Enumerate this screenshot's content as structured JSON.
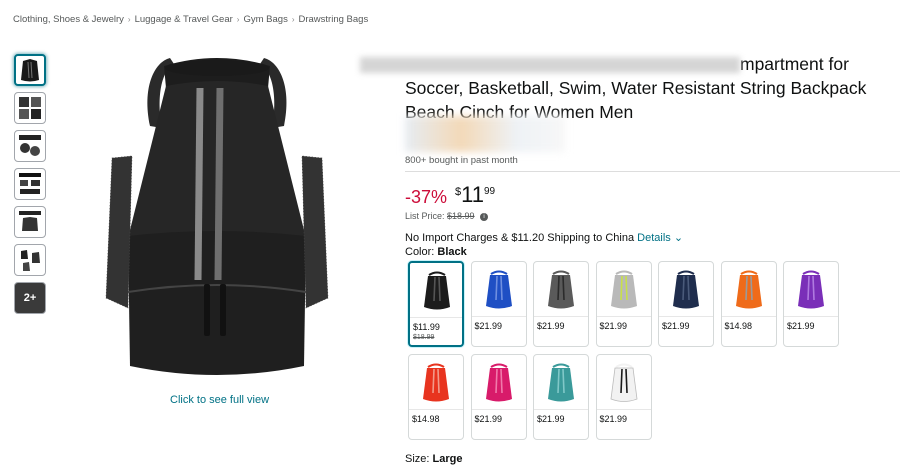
{
  "breadcrumb": [
    "Clothing, Shoes & Jewelry",
    "Luggage & Travel Gear",
    "Gym Bags",
    "Drawstring Bags"
  ],
  "breadcrumb_sep": "›",
  "thumbnails": {
    "more_label": "2+"
  },
  "see_full_link": "Click to see full view",
  "title": {
    "line1_visible": "mpartment for",
    "line2": "Soccer, Basketball, Swim, Water Resistant String Backpack",
    "line3": "Beach Cinch for Women Men"
  },
  "bought": "800+ bought in past month",
  "price": {
    "discount": "-37%",
    "currency": "$",
    "whole": "11",
    "fraction": "99",
    "list_label": "List Price:",
    "list_value": "$18.99",
    "info_icon": "i"
  },
  "shipping": {
    "text": "No Import Charges & $11.20 Shipping to China",
    "details_link": "Details",
    "chevron": "⌄"
  },
  "color": {
    "label": "Color:",
    "value": "Black"
  },
  "swatches": [
    {
      "price": "$11.99",
      "old": "$18.99",
      "color": "#1c1c1c",
      "accent": "#555555"
    },
    {
      "price": "$21.99",
      "old": "",
      "color": "#1f4fc4",
      "accent": "#6f8fe0"
    },
    {
      "price": "$21.99",
      "old": "",
      "color": "#5a5a5a",
      "accent": "#2b2b2b"
    },
    {
      "price": "$21.99",
      "old": "",
      "color": "#b9b9b9",
      "accent": "#c8e04a"
    },
    {
      "price": "$21.99",
      "old": "",
      "color": "#1f2d4d",
      "accent": "#4a5a7a"
    },
    {
      "price": "$14.98",
      "old": "",
      "color": "#ef6b1a",
      "accent": "#9a9a9a"
    },
    {
      "price": "$21.99",
      "old": "",
      "color": "#7a2fb8",
      "accent": "#b07ae0"
    },
    {
      "price": "$14.98",
      "old": "",
      "color": "#e8341f",
      "accent": "#f29a8a"
    },
    {
      "price": "$21.99",
      "old": "",
      "color": "#d81b6a",
      "accent": "#f07aab"
    },
    {
      "price": "$21.99",
      "old": "",
      "color": "#3a9a9a",
      "accent": "#80c8c8"
    },
    {
      "price": "$21.99",
      "old": "",
      "color": "#f2f2f2",
      "accent": "#1a1a1a"
    }
  ],
  "size": {
    "label": "Size:",
    "value": "Large"
  }
}
